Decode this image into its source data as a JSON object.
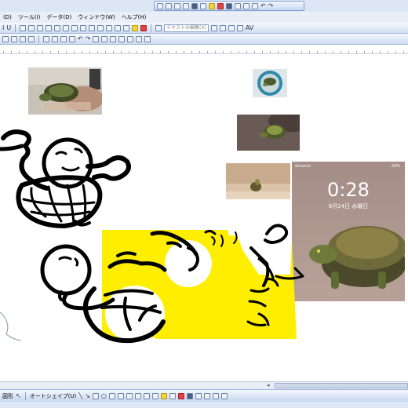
{
  "menu": {
    "items": [
      "(D)",
      "ツール(I)",
      "データ(D)",
      "ウィンドウ(W)",
      "ヘルプ(H)"
    ]
  },
  "toolbar": {
    "textbox_label": "テキストの編集(X)",
    "av_label": "AV"
  },
  "drawbar": {
    "draw_label": "図形",
    "autoshape_label": "オートシェイプ(U)"
  },
  "phone": {
    "carrier": "docomo",
    "battery": "24%",
    "time": "0:28",
    "date": "6月24日 水曜日"
  },
  "colors": {
    "highlight": "#ffee00",
    "toolbar_blue": "#c6d6f0",
    "ink": "#000000"
  }
}
